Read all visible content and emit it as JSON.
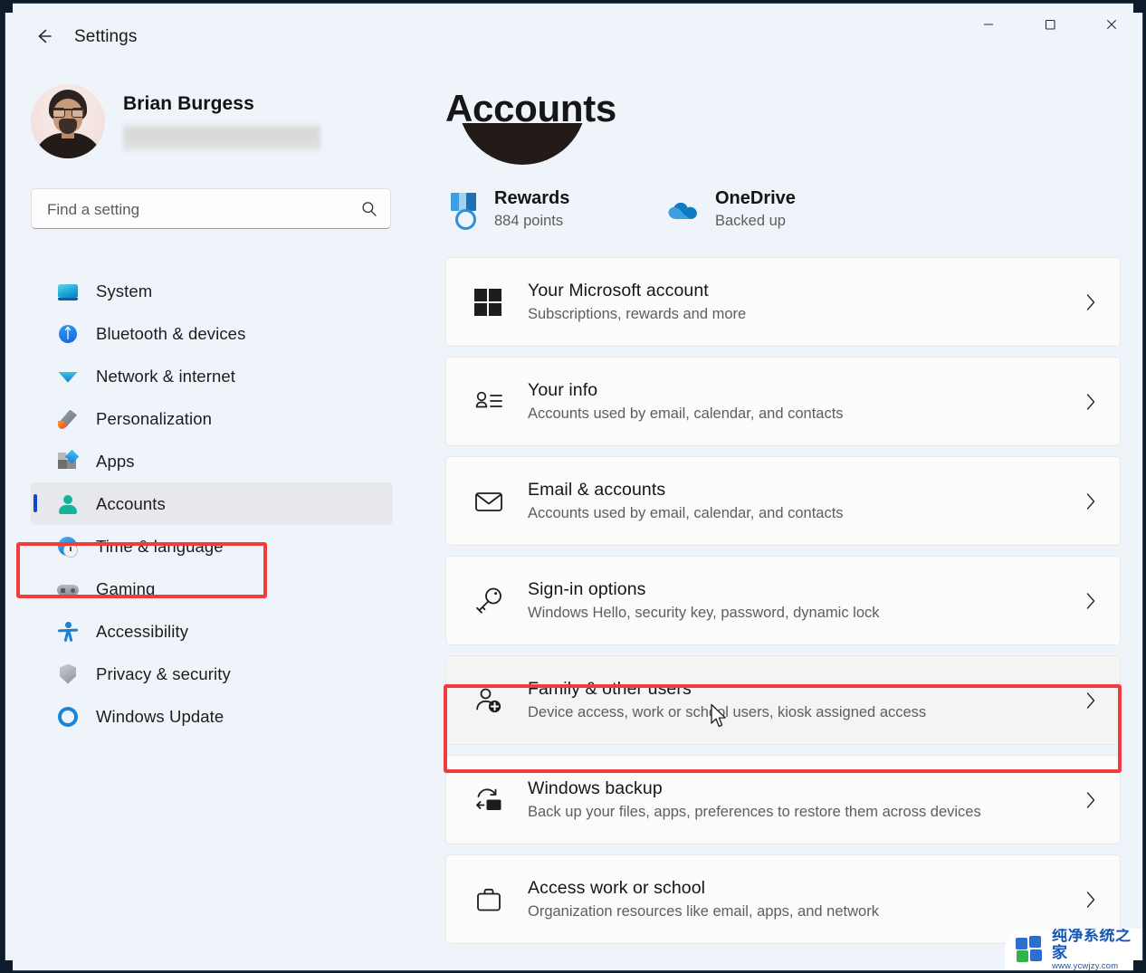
{
  "window": {
    "app_title": "Settings",
    "back_icon": "back-arrow-icon",
    "minimize_label": "—",
    "maximize_label": "□",
    "close_label": "✕"
  },
  "sidebar": {
    "account": {
      "name": "Brian Burgess",
      "email_redacted": true
    },
    "search": {
      "placeholder": "Find a setting",
      "value": "",
      "icon": "search-icon"
    },
    "items": [
      {
        "label": "System",
        "icon": "system-icon",
        "selected": false
      },
      {
        "label": "Bluetooth & devices",
        "icon": "bluetooth-icon",
        "selected": false
      },
      {
        "label": "Network & internet",
        "icon": "network-icon",
        "selected": false
      },
      {
        "label": "Personalization",
        "icon": "personalization-icon",
        "selected": false
      },
      {
        "label": "Apps",
        "icon": "apps-icon",
        "selected": false
      },
      {
        "label": "Accounts",
        "icon": "accounts-icon",
        "selected": true
      },
      {
        "label": "Time & language",
        "icon": "clock-icon",
        "selected": false
      },
      {
        "label": "Gaming",
        "icon": "gamepad-icon",
        "selected": false
      },
      {
        "label": "Accessibility",
        "icon": "accessibility-icon",
        "selected": false
      },
      {
        "label": "Privacy & security",
        "icon": "shield-icon",
        "selected": false
      },
      {
        "label": "Windows Update",
        "icon": "update-icon",
        "selected": false
      }
    ]
  },
  "main": {
    "page_title": "Accounts",
    "quick_links": [
      {
        "title": "Rewards",
        "sub": "884 points",
        "icon": "rewards-medal-icon"
      },
      {
        "title": "OneDrive",
        "sub": "Backed up",
        "icon": "onedrive-cloud-icon"
      }
    ],
    "cards": [
      {
        "title": "Your Microsoft account",
        "sub": "Subscriptions, rewards and more",
        "icon": "microsoft-logo-icon",
        "active": false
      },
      {
        "title": "Your info",
        "sub": "Accounts used by email, calendar, and contacts",
        "icon": "user-info-icon",
        "active": false
      },
      {
        "title": "Email & accounts",
        "sub": "Accounts used by email, calendar, and contacts",
        "icon": "envelope-icon",
        "active": false
      },
      {
        "title": "Sign-in options",
        "sub": "Windows Hello, security key, password, dynamic lock",
        "icon": "key-icon",
        "active": false
      },
      {
        "title": "Family & other users",
        "sub": "Device access, work or school users, kiosk assigned access",
        "icon": "add-user-icon",
        "active": true
      },
      {
        "title": "Windows backup",
        "sub": "Back up your files, apps, preferences to restore them across devices",
        "icon": "backup-icon",
        "active": false
      },
      {
        "title": "Access work or school",
        "sub": "Organization resources like email, apps, and network",
        "icon": "briefcase-icon",
        "active": false
      }
    ],
    "chevron_icon": "chevron-right-icon"
  },
  "annotations": {
    "color": "#f23c3c",
    "boxes": [
      "accounts-sidebar-item",
      "family-and-other-users-card"
    ]
  },
  "cursor": {
    "icon": "mouse-pointer-icon"
  },
  "watermark": {
    "title": "纯净系统之家",
    "url": "www.ycwjzy.com"
  },
  "colors": {
    "page_bg": "#eff3fa",
    "card_bg": "#fbfbfb",
    "accent_pill": "#0d47c4",
    "annotation_red": "#f23c3c",
    "desktop": "#0d1b2a"
  }
}
